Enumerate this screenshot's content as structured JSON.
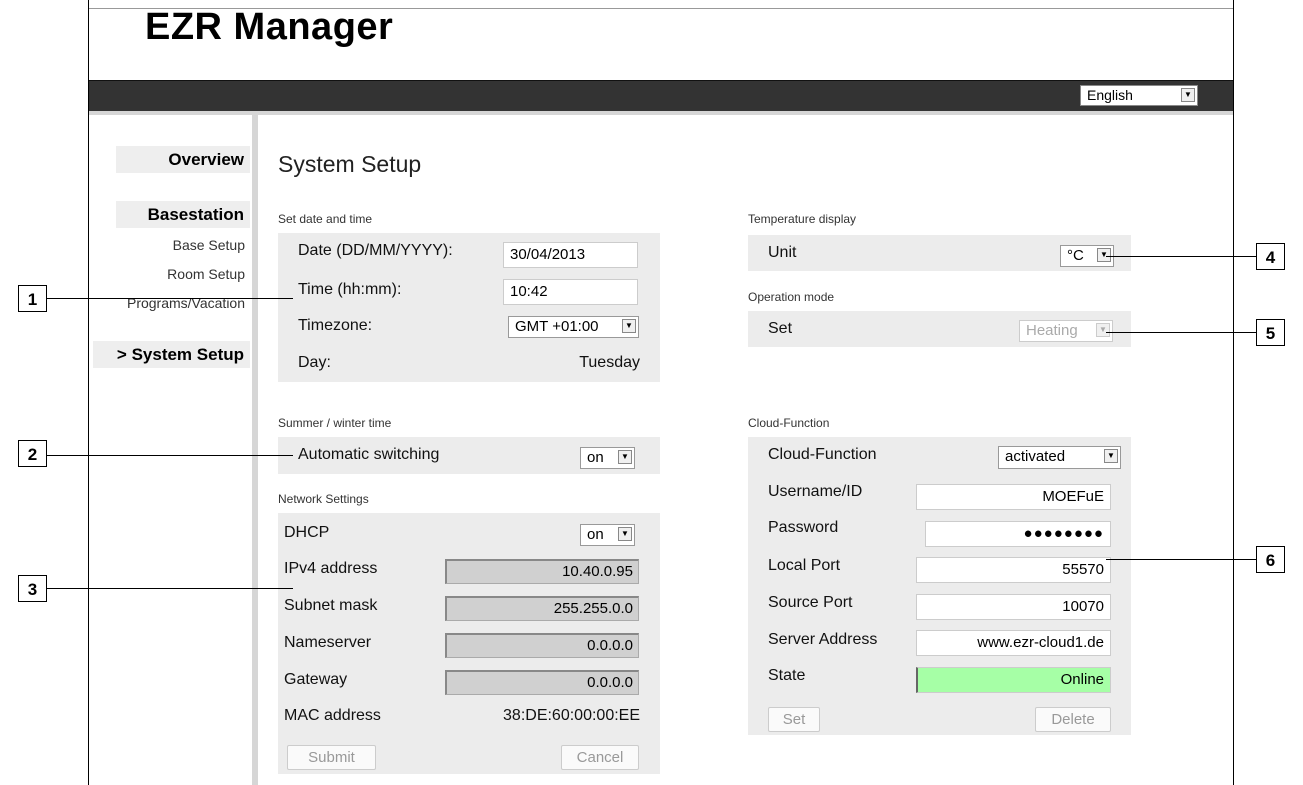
{
  "app": {
    "title": "EZR Manager"
  },
  "header": {
    "language": "English"
  },
  "sidebar": {
    "overview": "Overview",
    "basestation": "Basestation",
    "base_setup": "Base Setup",
    "room_setup": "Room Setup",
    "programs_vacation": "Programs/Vacation",
    "system_setup": "> System Setup"
  },
  "page": {
    "title": "System Setup"
  },
  "datetime": {
    "section": "Set date and time",
    "date_label": "Date (DD/MM/YYYY):",
    "date_value": "30/04/2013",
    "time_label": "Time (hh:mm):",
    "time_value": "10:42",
    "timezone_label": "Timezone:",
    "timezone_value": "GMT +01:00",
    "day_label": "Day:",
    "day_value": "Tuesday"
  },
  "summer": {
    "section": "Summer / winter time",
    "auto_label": "Automatic switching",
    "auto_value": "on"
  },
  "network": {
    "section": "Network Settings",
    "dhcp_label": "DHCP",
    "dhcp_value": "on",
    "ipv4_label": "IPv4 address",
    "ipv4_value": "10.40.0.95",
    "subnet_label": "Subnet mask",
    "subnet_value": "255.255.0.0",
    "ns_label": "Nameserver",
    "ns_value": "0.0.0.0",
    "gw_label": "Gateway",
    "gw_value": "0.0.0.0",
    "mac_label": "MAC address",
    "mac_value": "38:DE:60:00:00:EE",
    "submit": "Submit",
    "cancel": "Cancel"
  },
  "temperature": {
    "section": "Temperature display",
    "unit_label": "Unit",
    "unit_value": "°C"
  },
  "operation": {
    "section": "Operation mode",
    "set_label": "Set",
    "set_value": "Heating"
  },
  "cloud": {
    "section": "Cloud-Function",
    "func_label": "Cloud-Function",
    "func_value": "activated",
    "user_label": "Username/ID",
    "user_value": "MOEFuE",
    "pass_label": "Password",
    "pass_value": "●●●●●●●●",
    "local_label": "Local Port",
    "local_value": "55570",
    "source_label": "Source Port",
    "source_value": "10070",
    "server_label": "Server Address",
    "server_value": "www.ezr-cloud1.de",
    "state_label": "State",
    "state_value": "Online",
    "set_button": "Set",
    "delete_button": "Delete",
    "state_color": "#a6ffa6"
  },
  "callouts": [
    "1",
    "2",
    "3",
    "4",
    "5",
    "6"
  ]
}
